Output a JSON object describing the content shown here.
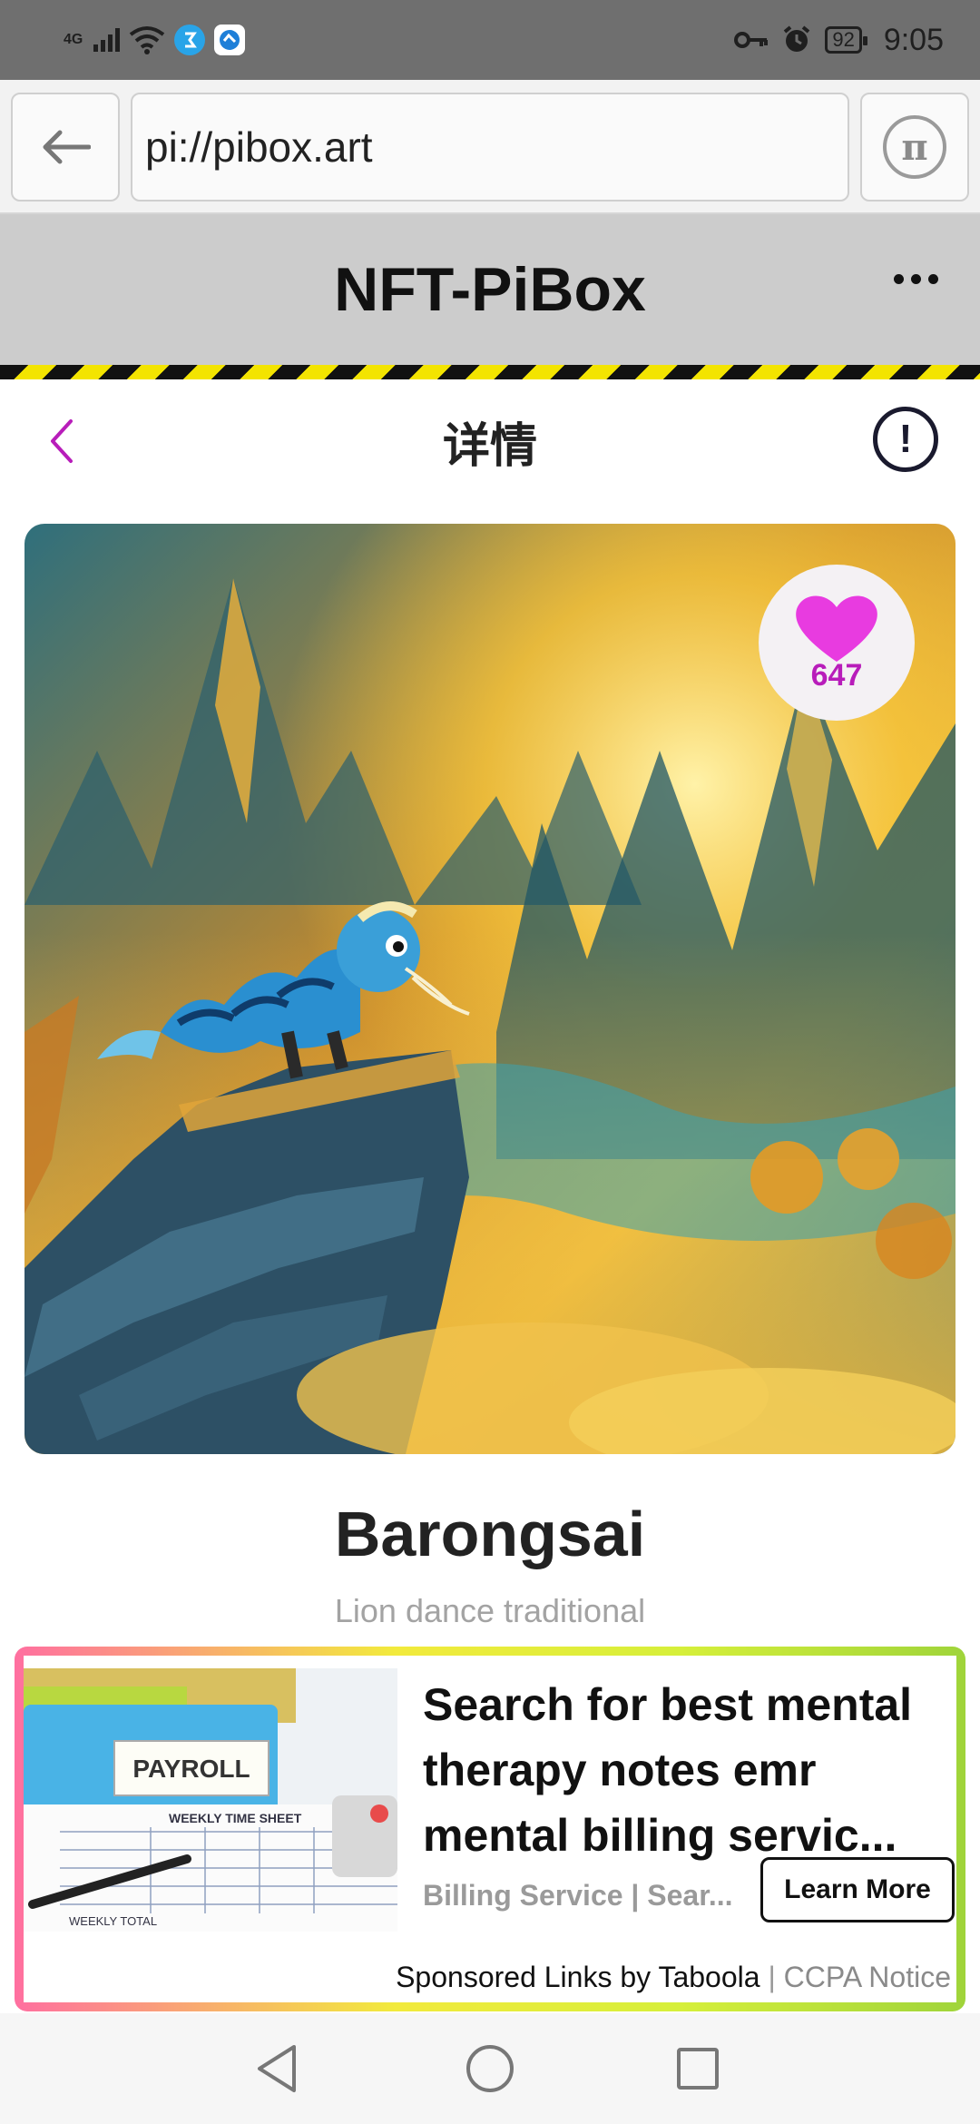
{
  "status_bar": {
    "network": "4G",
    "time": "9:05",
    "battery": "92",
    "icons": [
      "signal-icon",
      "wifi-icon",
      "app-notification-icon",
      "app-notification-icon",
      "key-icon",
      "alarm-icon",
      "battery-icon"
    ]
  },
  "browser": {
    "url": "pi://pibox.art",
    "back_icon": "arrow-left-icon",
    "pi_icon": "pi-logo-icon"
  },
  "app": {
    "title": "NFT-PiBox",
    "menu_icon": "more-horizontal-icon"
  },
  "page": {
    "title": "详情",
    "back_icon": "chevron-left-icon",
    "info_icon": "exclamation-circle-icon"
  },
  "nft": {
    "like_count": "647",
    "name": "Barongsai",
    "description": "Lion dance traditional"
  },
  "ad": {
    "headline": "Search for best mental therapy notes emr mental billing servic...",
    "source": "Billing Service | Sear...",
    "cta": "Learn More",
    "footer_sponsor": "Sponsored Links by Taboola",
    "footer_sep": "|",
    "footer_ccpa": "CCPA Notice",
    "thumb_label": "PAYROLL",
    "thumb_sheet": "WEEKLY TIME SHEET",
    "thumb_total": "WEEKLY TOTAL"
  },
  "colors": {
    "accent": "#b81dba",
    "heart": "#e83be0",
    "header_bg": "#cccccc"
  }
}
